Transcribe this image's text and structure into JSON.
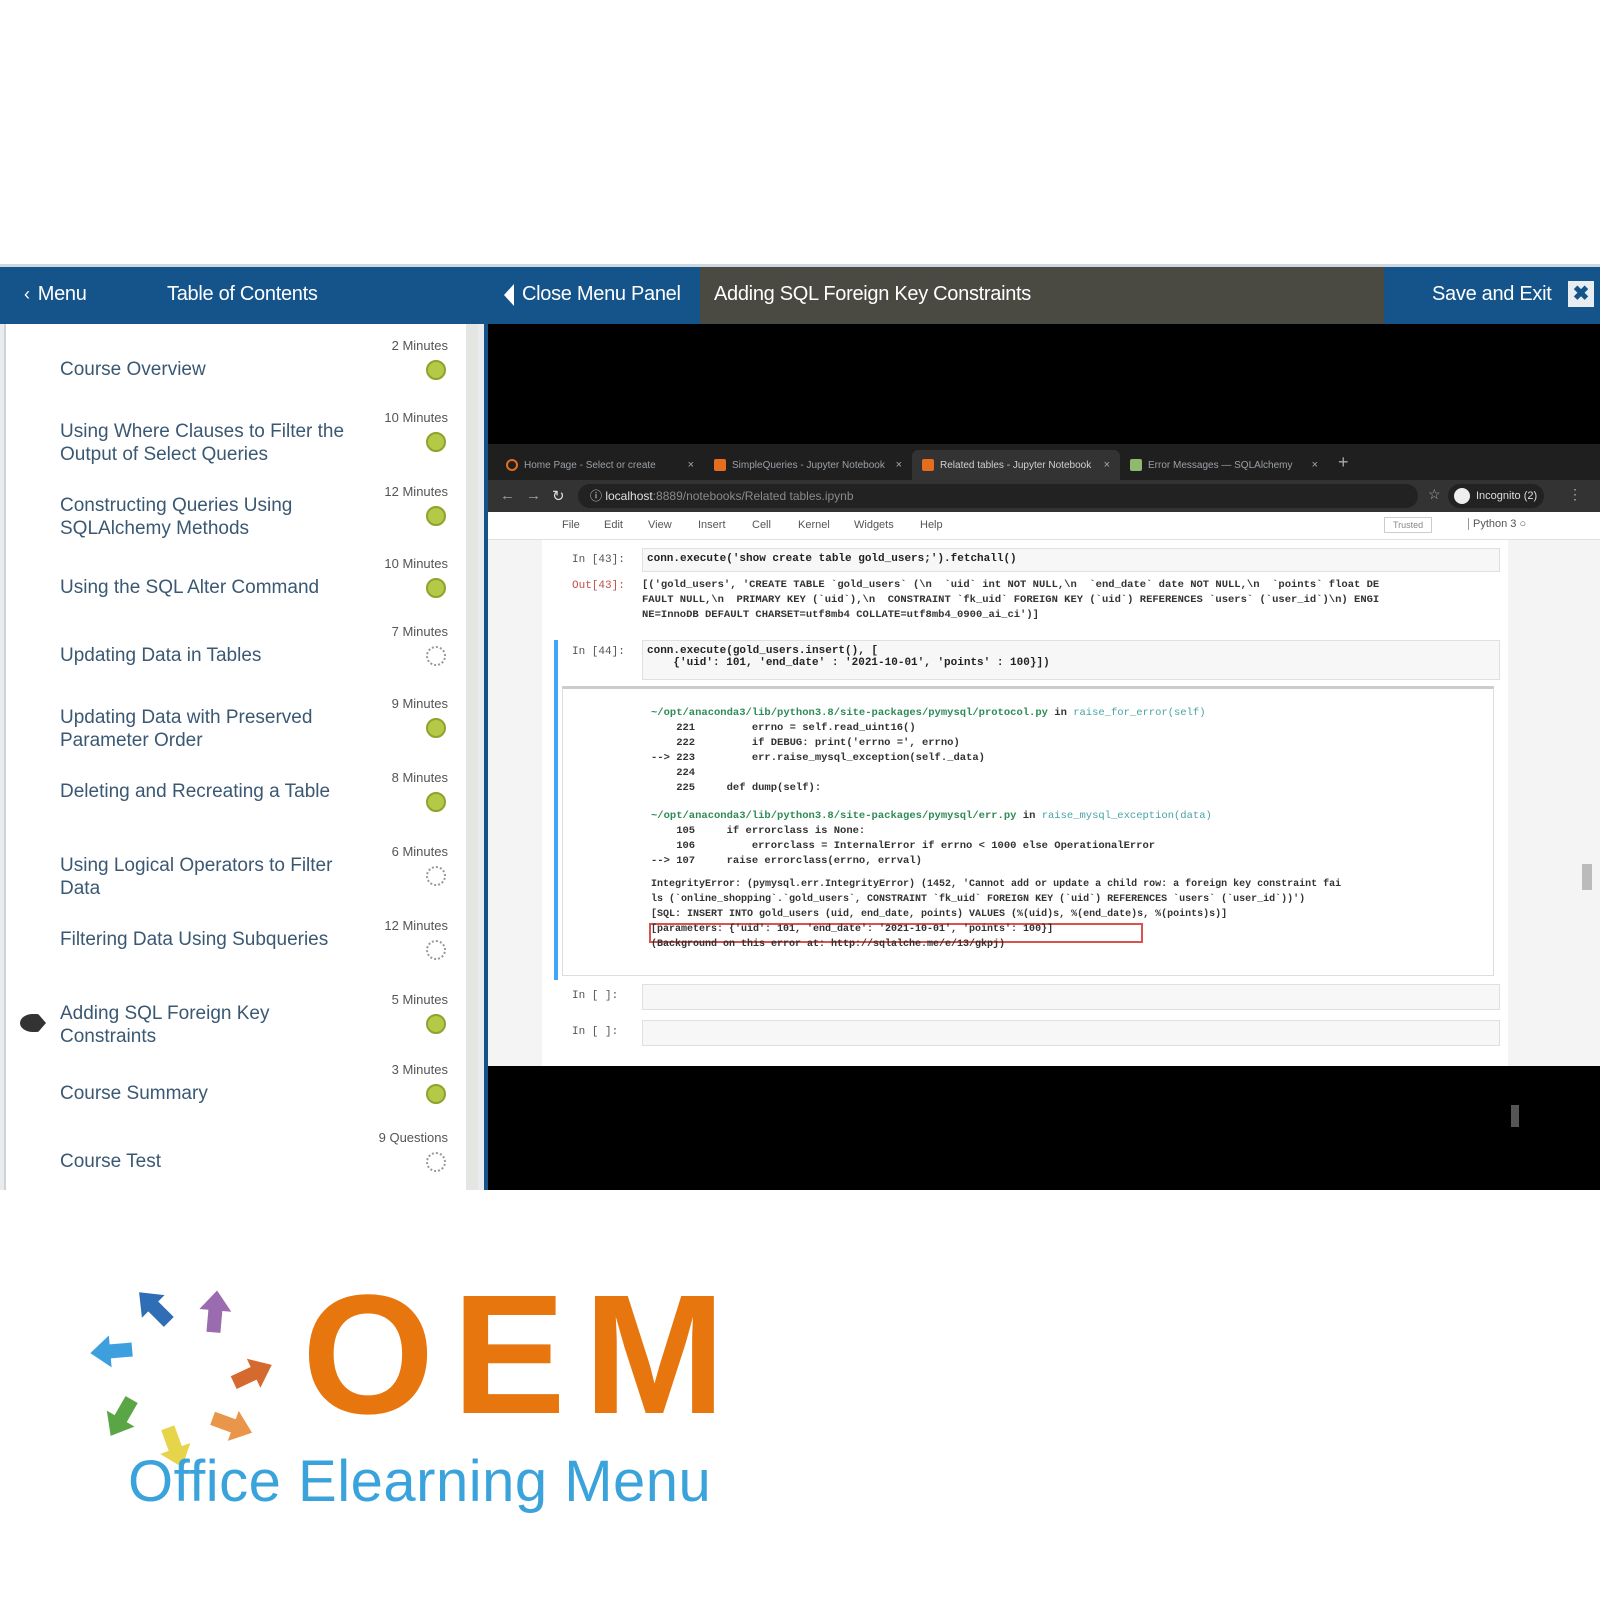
{
  "topbar": {
    "menu_label": "Menu",
    "toc_label": "Table of Contents",
    "close_panel_label": "Close Menu Panel",
    "course_title": "Adding SQL Foreign Key Constraints",
    "save_exit_label": "Save and Exit",
    "close_symbol": "✖"
  },
  "toc": {
    "items": [
      {
        "title": "Course Overview",
        "duration": "2 Minutes",
        "status": "complete"
      },
      {
        "title": "Using Where Clauses to Filter the Output of Select Queries",
        "duration": "10 Minutes",
        "status": "complete"
      },
      {
        "title": "Constructing Queries Using SQLAlchemy Methods",
        "duration": "12 Minutes",
        "status": "complete"
      },
      {
        "title": "Using the SQL Alter Command",
        "duration": "10 Minutes",
        "status": "complete"
      },
      {
        "title": "Updating Data in Tables",
        "duration": "7 Minutes",
        "status": "not-started"
      },
      {
        "title": "Updating Data with Preserved Parameter Order",
        "duration": "9 Minutes",
        "status": "complete"
      },
      {
        "title": "Deleting and Recreating a Table",
        "duration": "8 Minutes",
        "status": "complete"
      },
      {
        "title": "Using Logical Operators to Filter Data",
        "duration": "6 Minutes",
        "status": "not-started"
      },
      {
        "title": "Filtering Data Using Subqueries",
        "duration": "12 Minutes",
        "status": "not-started"
      },
      {
        "title": "Adding SQL Foreign Key Constraints",
        "duration": "5 Minutes",
        "status": "complete",
        "current": true
      },
      {
        "title": "Course Summary",
        "duration": "3 Minutes",
        "status": "complete"
      },
      {
        "title": "Course Test",
        "duration": "9 Questions",
        "status": "not-started"
      }
    ]
  },
  "browser": {
    "tabs": [
      {
        "title": "Home Page - Select or create",
        "active": false
      },
      {
        "title": "SimpleQueries - Jupyter Notebook",
        "active": false
      },
      {
        "title": "Related tables - Jupyter Notebook",
        "active": true
      },
      {
        "title": "Error Messages — SQLAlchemy",
        "active": false
      }
    ],
    "close_tab": "×",
    "new_tab": "+",
    "url_host": "localhost",
    "url_path": ":8889/notebooks/Related tables.ipynb",
    "profile_label": "Incognito (2)",
    "jupyter_menu": [
      "File",
      "Edit",
      "View",
      "Insert",
      "Cell",
      "Kernel",
      "Widgets",
      "Help"
    ],
    "trusted_label": "Trusted",
    "kernel_label": "Python 3"
  },
  "notebook": {
    "cell1_prompt": "In [43]:",
    "cell1_code": "conn.execute('show create table gold_users;').fetchall()",
    "out1_prompt": "Out[43]:",
    "out1_lines": [
      "[('gold_users', 'CREATE TABLE `gold_users` (\\n  `uid` int NOT NULL,\\n  `end_date` date NOT NULL,\\n  `points` float DE",
      "FAULT NULL,\\n  PRIMARY KEY (`uid`),\\n  CONSTRAINT `fk_uid` FOREIGN KEY (`uid`) REFERENCES `users` (`user_id`)\\n) ENGI",
      "NE=InnoDB DEFAULT CHARSET=utf8mb4 COLLATE=utf8mb4_0900_ai_ci')]"
    ],
    "cell2_prompt": "In [44]:",
    "cell2_code_lines": [
      "conn.execute(gold_users.insert(), [",
      "    {'uid': 101, 'end_date' : '2021-10-01', 'points' : 100}])"
    ],
    "trace": [
      {
        "kind": "path",
        "text": "~/opt/anaconda3/lib/python3.8/site-packages/pymysql/protocol.py",
        "in": " in ",
        "func": "raise_for_error(self)"
      },
      {
        "kind": "code",
        "text": "    221         errno = self.read_uint16()"
      },
      {
        "kind": "code",
        "text": "    222         if DEBUG: print('errno =', errno)"
      },
      {
        "kind": "code",
        "text": "--> 223         err.raise_mysql_exception(self._data)"
      },
      {
        "kind": "code",
        "text": "    224"
      },
      {
        "kind": "code",
        "text": "    225     def dump(self):"
      },
      {
        "kind": "path",
        "text": "~/opt/anaconda3/lib/python3.8/site-packages/pymysql/err.py",
        "in": " in ",
        "func": "raise_mysql_exception(data)"
      },
      {
        "kind": "code",
        "text": "    105     if errorclass is None:"
      },
      {
        "kind": "code",
        "text": "    106         errorclass = InternalError if errno < 1000 else OperationalError"
      },
      {
        "kind": "code",
        "text": "--> 107     raise errorclass(errno, errval)"
      }
    ],
    "error_lines": [
      "IntegrityError: (pymysql.err.IntegrityError) (1452, 'Cannot add or update a child row: a foreign key constraint fai",
      "ls (`online_shopping`.`gold_users`, CONSTRAINT `fk_uid` FOREIGN KEY (`uid`) REFERENCES `users` (`user_id`))')",
      "[SQL: INSERT INTO gold_users (uid, end_date, points) VALUES (%(uid)s, %(end_date)s, %(points)s)]",
      "[parameters: {'uid': 101, 'end_date': '2021-10-01', 'points': 100}]",
      "(Background on this error at: http://sqlalche.me/e/13/gkpj)"
    ],
    "empty_prompt": "In [ ]:"
  },
  "logo": {
    "acronym": "OEM",
    "name": "Office Elearning Menu",
    "arrow_colors": [
      "#2f6db5",
      "#9b6bb0",
      "#d46a2e",
      "#e9964b",
      "#e6d44a",
      "#5aa646",
      "#3e9fde"
    ]
  }
}
